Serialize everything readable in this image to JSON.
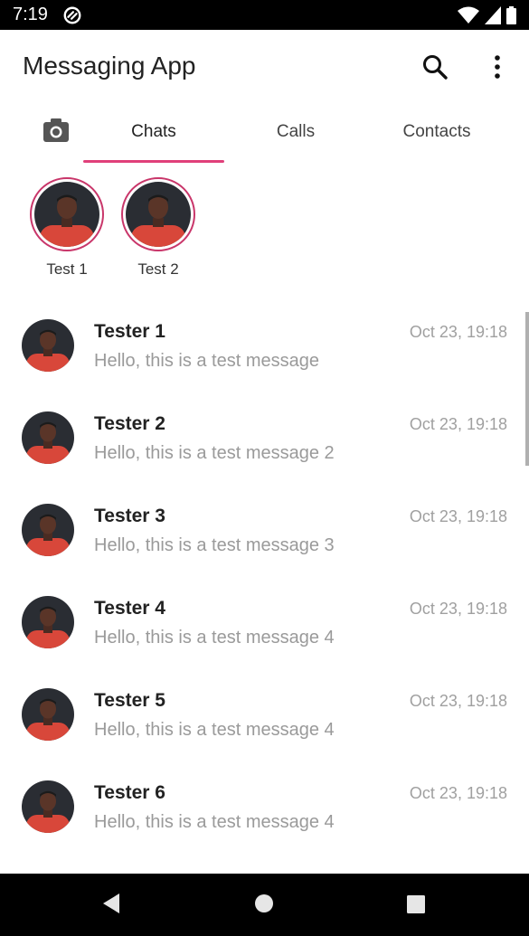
{
  "status_bar": {
    "time": "7:19",
    "icons": [
      "app-notification-icon",
      "wifi-icon",
      "signal-icon",
      "battery-icon"
    ]
  },
  "app_bar": {
    "title": "Messaging App",
    "actions": [
      "search-icon",
      "more-vert-icon"
    ]
  },
  "tabs": {
    "camera_icon": "camera-icon",
    "items": [
      {
        "label": "Chats"
      },
      {
        "label": "Calls"
      },
      {
        "label": "Contacts"
      }
    ],
    "active": "Chats",
    "accent_color": "#e0407a"
  },
  "stories": [
    {
      "name": "Test 1"
    },
    {
      "name": "Test 2"
    }
  ],
  "chats": [
    {
      "name": "Tester 1",
      "message": "Hello, this is a test message",
      "time": "Oct 23, 19:18"
    },
    {
      "name": "Tester 2",
      "message": "Hello, this is a test message 2",
      "time": "Oct 23, 19:18"
    },
    {
      "name": "Tester 3",
      "message": "Hello, this is a test message 3",
      "time": "Oct 23, 19:18"
    },
    {
      "name": "Tester 4",
      "message": "Hello, this is a test message 4",
      "time": "Oct 23, 19:18"
    },
    {
      "name": "Tester 5",
      "message": "Hello, this is a test message 4",
      "time": "Oct 23, 19:18"
    },
    {
      "name": "Tester 6",
      "message": "Hello, this is a test message 4",
      "time": "Oct 23, 19:18"
    }
  ],
  "nav_bar": {
    "buttons": [
      "back-icon",
      "home-icon",
      "recents-icon"
    ]
  }
}
